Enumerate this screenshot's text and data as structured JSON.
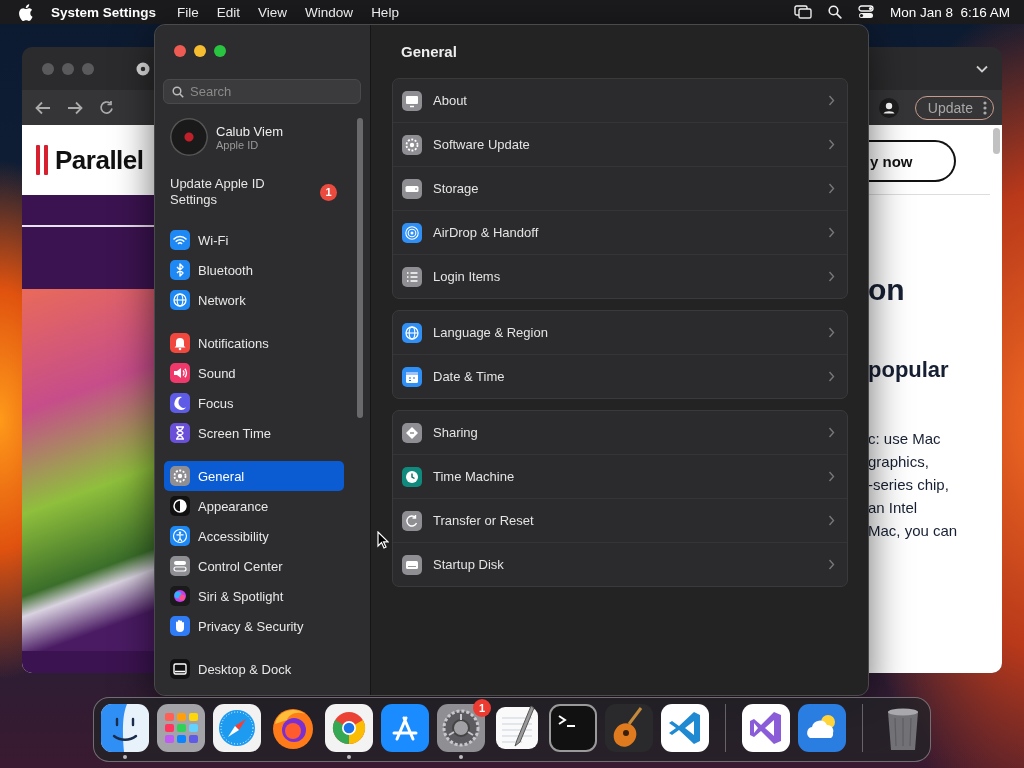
{
  "menu_bar": {
    "app_name": "System Settings",
    "menus": [
      "File",
      "Edit",
      "View",
      "Window",
      "Help"
    ],
    "clock": "Mon Jan 8  6:16 AM"
  },
  "browser_window": {
    "update_button": "Update",
    "logo_text": "Parallel",
    "buy_button_text": "y now",
    "heading_fragment": "on",
    "subheading_fragment": "popular",
    "paragraph_lines": [
      "c: use Mac",
      "graphics,",
      "-series chip,",
      "an Intel",
      "Mac, you can"
    ]
  },
  "settings_window": {
    "search": {
      "placeholder": "Search"
    },
    "account": {
      "name": "Calub Viem",
      "subtitle": "Apple ID"
    },
    "notice": {
      "text": "Update Apple ID Settings",
      "badge": "1"
    },
    "sidebar_groups": [
      {
        "items": [
          {
            "label": "Wi-Fi",
            "kind": "wifi",
            "selected": false
          },
          {
            "label": "Bluetooth",
            "kind": "bluetooth",
            "selected": false
          },
          {
            "label": "Network",
            "kind": "network",
            "selected": false
          }
        ]
      },
      {
        "items": [
          {
            "label": "Notifications",
            "kind": "notifications",
            "selected": false
          },
          {
            "label": "Sound",
            "kind": "sound",
            "selected": false
          },
          {
            "label": "Focus",
            "kind": "focus",
            "selected": false
          },
          {
            "label": "Screen Time",
            "kind": "screentime",
            "selected": false
          }
        ]
      },
      {
        "items": [
          {
            "label": "General",
            "kind": "general",
            "selected": true
          },
          {
            "label": "Appearance",
            "kind": "appearance",
            "selected": false
          },
          {
            "label": "Accessibility",
            "kind": "accessibility",
            "selected": false
          },
          {
            "label": "Control Center",
            "kind": "controlcenter",
            "selected": false
          },
          {
            "label": "Siri & Spotlight",
            "kind": "siri",
            "selected": false
          },
          {
            "label": "Privacy & Security",
            "kind": "privacy",
            "selected": false
          }
        ]
      },
      {
        "items": [
          {
            "label": "Desktop & Dock",
            "kind": "desktop",
            "selected": false
          }
        ]
      }
    ],
    "title": "General",
    "groups": [
      {
        "rows": [
          {
            "label": "About",
            "kind": "about"
          },
          {
            "label": "Software Update",
            "kind": "update"
          },
          {
            "label": "Storage",
            "kind": "storage"
          },
          {
            "label": "AirDrop & Handoff",
            "kind": "airdrop"
          },
          {
            "label": "Login Items",
            "kind": "login"
          }
        ]
      },
      {
        "rows": [
          {
            "label": "Language & Region",
            "kind": "language"
          },
          {
            "label": "Date & Time",
            "kind": "datetime"
          }
        ]
      },
      {
        "rows": [
          {
            "label": "Sharing",
            "kind": "sharing"
          },
          {
            "label": "Time Machine",
            "kind": "timemachine"
          },
          {
            "label": "Transfer or Reset",
            "kind": "transfer"
          },
          {
            "label": "Startup Disk",
            "kind": "startup"
          }
        ]
      }
    ]
  },
  "dock": {
    "sections": [
      {
        "items": [
          {
            "kind": "finder",
            "running": true
          },
          {
            "kind": "launchpad",
            "running": false
          },
          {
            "kind": "safari",
            "running": false
          },
          {
            "kind": "firefox",
            "running": false
          },
          {
            "kind": "chrome",
            "running": true
          },
          {
            "kind": "appstore",
            "running": false
          },
          {
            "kind": "settings",
            "running": true,
            "badge": "1"
          },
          {
            "kind": "textedit",
            "running": false
          },
          {
            "kind": "terminal",
            "running": false
          },
          {
            "kind": "garageband",
            "running": false
          },
          {
            "kind": "vscode",
            "running": false
          }
        ]
      },
      {
        "items": [
          {
            "kind": "visualstudio",
            "running": false
          },
          {
            "kind": "weather",
            "running": false
          }
        ]
      },
      {
        "items": [
          {
            "kind": "trash",
            "running": false
          }
        ]
      }
    ]
  }
}
